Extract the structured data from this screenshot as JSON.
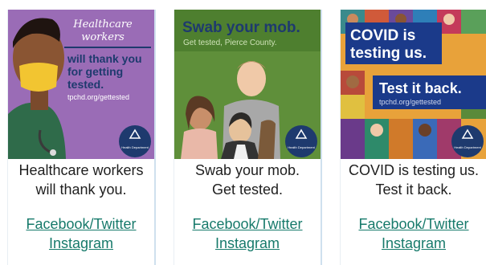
{
  "cards": [
    {
      "poster": {
        "headline_line1": "Healthcare",
        "headline_line2": "workers",
        "body_line1": "will thank you",
        "body_line2": "for getting",
        "body_line3": "tested.",
        "url": "tpchd.org/gettested",
        "logo_text": "Health Department"
      },
      "caption_line1": "Healthcare workers",
      "caption_line2": "will thank you.",
      "link1": "Facebook/Twitter",
      "link2": "Instagram"
    },
    {
      "poster": {
        "headline": "Swab your mob.",
        "subline": "Get tested, Pierce County.",
        "logo_text": "Health Department"
      },
      "caption_line1": "Swab your mob.",
      "caption_line2": "Get tested.",
      "link1": "Facebook/Twitter",
      "link2": "Instagram"
    },
    {
      "poster": {
        "headline_line1": "COVID is",
        "headline_line2": "testing us.",
        "sub_headline": "Test it back.",
        "url": "tpchd.org/gettested",
        "logo_text": "Health Department"
      },
      "caption_line1": "COVID is testing us.",
      "caption_line2": "Test it back.",
      "link1": "Facebook/Twitter",
      "link2": "Instagram"
    }
  ],
  "colors": {
    "link": "#177a6b",
    "poster1_bg": "#9a6cb6",
    "poster2_bg": "#5f8f3a",
    "poster3_banner": "#1b3a8a",
    "logo_navy": "#1e3a6e"
  }
}
